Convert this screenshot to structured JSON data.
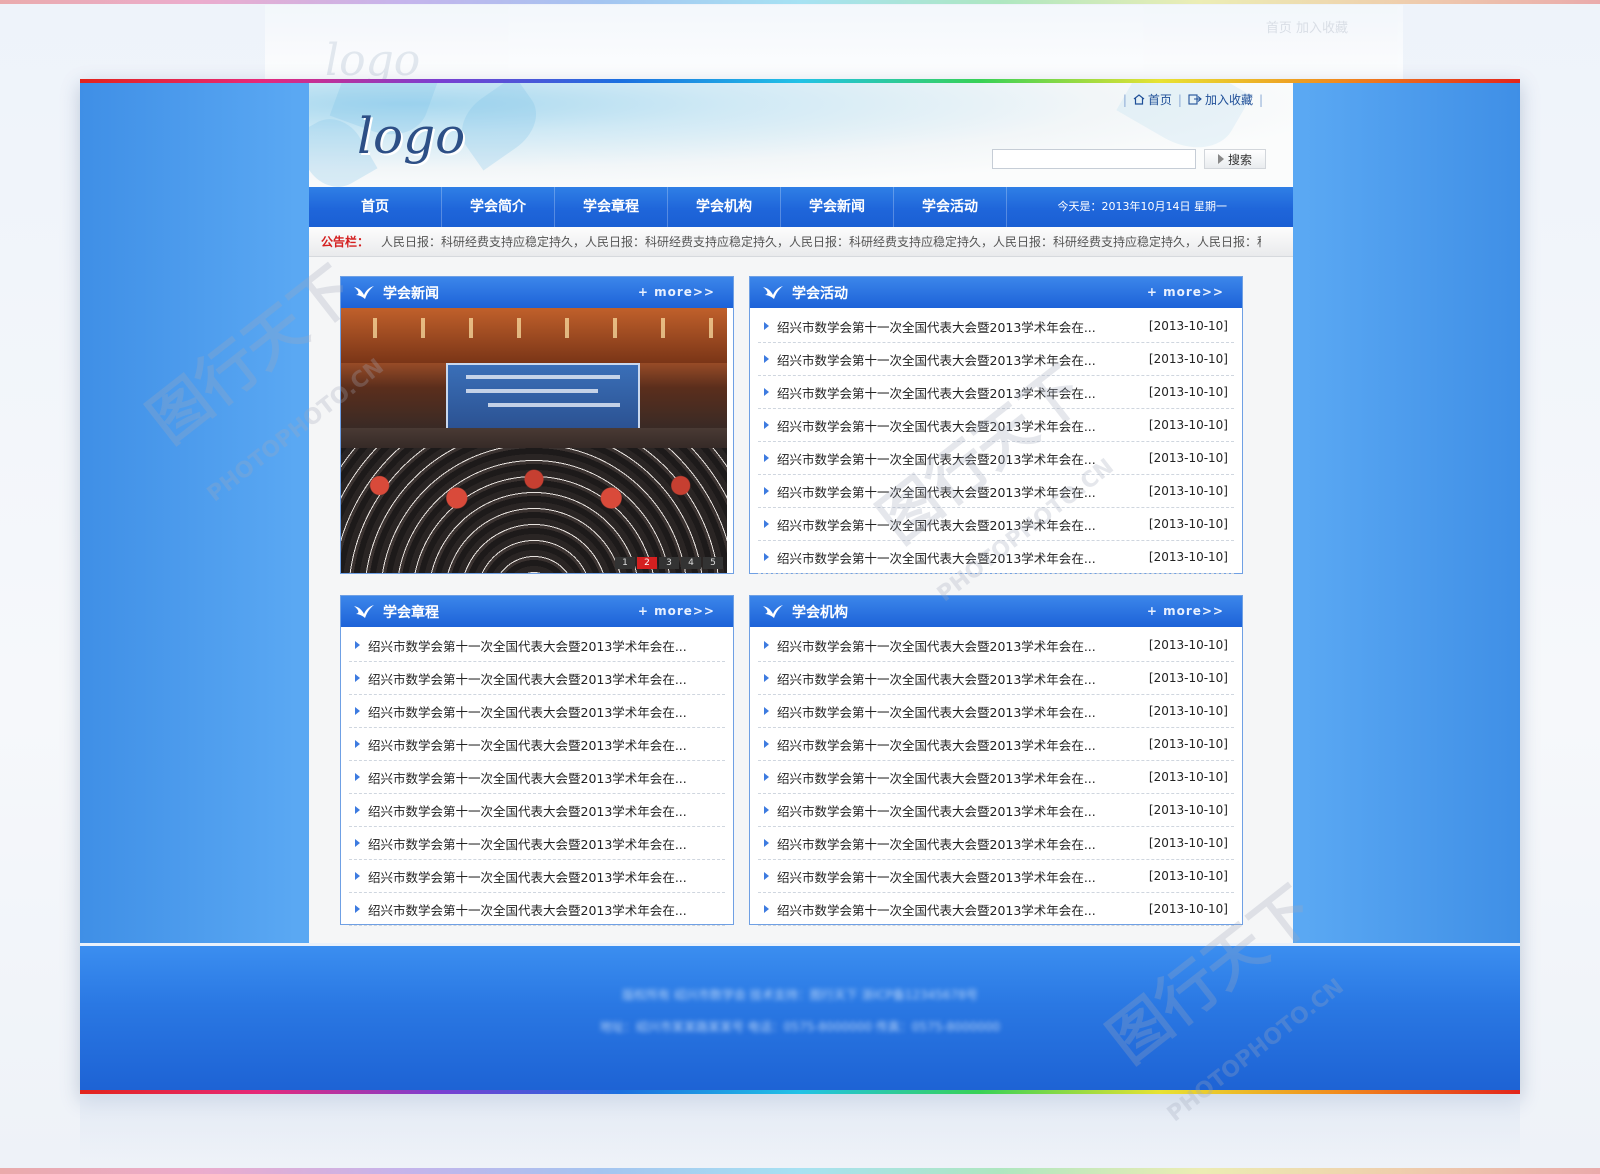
{
  "ghost": {
    "logo": "logo",
    "links": "首页  加入收藏"
  },
  "header": {
    "logo": "logo",
    "home_link": "首页",
    "favorite_link": "加入收藏",
    "search_placeholder": "",
    "search_button": "搜索"
  },
  "nav": {
    "items": [
      "首页",
      "学会简介",
      "学会章程",
      "学会机构",
      "学会新闻",
      "学会活动"
    ],
    "date": "今天是：2013年10月14日   星期一"
  },
  "notice": {
    "label": "公告栏：",
    "text": "人民日报：科研经费支持应稳定持久，人民日报：科研经费支持应稳定持久，人民日报：科研经费支持应稳定持久，人民日报：科研经费支持应稳定持久，人民日报：科研经费支持"
  },
  "news": {
    "title": "学会新闻",
    "more": "+ more>>",
    "pager": [
      "1",
      "2",
      "3",
      "4",
      "5"
    ]
  },
  "activities": {
    "title": "学会活动",
    "more": "+ more>>",
    "items": [
      {
        "title": "绍兴市数学会第十一次全国代表大会暨2013学术年会在...",
        "date": "[2013-10-10]"
      },
      {
        "title": "绍兴市数学会第十一次全国代表大会暨2013学术年会在...",
        "date": "[2013-10-10]"
      },
      {
        "title": "绍兴市数学会第十一次全国代表大会暨2013学术年会在...",
        "date": "[2013-10-10]"
      },
      {
        "title": "绍兴市数学会第十一次全国代表大会暨2013学术年会在...",
        "date": "[2013-10-10]"
      },
      {
        "title": "绍兴市数学会第十一次全国代表大会暨2013学术年会在...",
        "date": "[2013-10-10]"
      },
      {
        "title": "绍兴市数学会第十一次全国代表大会暨2013学术年会在...",
        "date": "[2013-10-10]"
      },
      {
        "title": "绍兴市数学会第十一次全国代表大会暨2013学术年会在...",
        "date": "[2013-10-10]"
      },
      {
        "title": "绍兴市数学会第十一次全国代表大会暨2013学术年会在...",
        "date": "[2013-10-10]"
      }
    ]
  },
  "charter": {
    "title": "学会章程",
    "more": "+ more>>",
    "items": [
      "绍兴市数学会第十一次全国代表大会暨2013学术年会在...",
      "绍兴市数学会第十一次全国代表大会暨2013学术年会在...",
      "绍兴市数学会第十一次全国代表大会暨2013学术年会在...",
      "绍兴市数学会第十一次全国代表大会暨2013学术年会在...",
      "绍兴市数学会第十一次全国代表大会暨2013学术年会在...",
      "绍兴市数学会第十一次全国代表大会暨2013学术年会在...",
      "绍兴市数学会第十一次全国代表大会暨2013学术年会在...",
      "绍兴市数学会第十一次全国代表大会暨2013学术年会在...",
      "绍兴市数学会第十一次全国代表大会暨2013学术年会在..."
    ]
  },
  "organization": {
    "title": "学会机构",
    "more": "+ more>>",
    "items": [
      {
        "title": "绍兴市数学会第十一次全国代表大会暨2013学术年会在...",
        "date": "[2013-10-10]"
      },
      {
        "title": "绍兴市数学会第十一次全国代表大会暨2013学术年会在...",
        "date": "[2013-10-10]"
      },
      {
        "title": "绍兴市数学会第十一次全国代表大会暨2013学术年会在...",
        "date": "[2013-10-10]"
      },
      {
        "title": "绍兴市数学会第十一次全国代表大会暨2013学术年会在...",
        "date": "[2013-10-10]"
      },
      {
        "title": "绍兴市数学会第十一次全国代表大会暨2013学术年会在...",
        "date": "[2013-10-10]"
      },
      {
        "title": "绍兴市数学会第十一次全国代表大会暨2013学术年会在...",
        "date": "[2013-10-10]"
      },
      {
        "title": "绍兴市数学会第十一次全国代表大会暨2013学术年会在...",
        "date": "[2013-10-10]"
      },
      {
        "title": "绍兴市数学会第十一次全国代表大会暨2013学术年会在...",
        "date": "[2013-10-10]"
      },
      {
        "title": "绍兴市数学会第十一次全国代表大会暨2013学术年会在...",
        "date": "[2013-10-10]"
      }
    ]
  },
  "footer": {
    "line1": "版权所有  绍兴市数学会      技术支持：图行天下      浙ICP备12345678号",
    "line2": "地址：绍兴市某某路某某号      电话：0575-8000000      传真：0575-8000000"
  },
  "watermark": {
    "cn": "图行天下",
    "en": "PHOTOPHOTO.CN"
  },
  "colors": {
    "nav_blue": "#1f66da",
    "frame_blue": "#5aa8f3",
    "notice_red": "#d42020",
    "panel_border": "#6fa0e4"
  }
}
